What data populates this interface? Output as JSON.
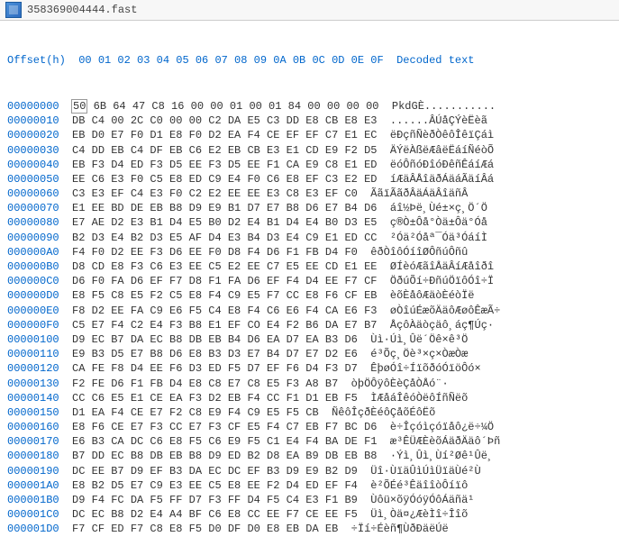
{
  "title": "358369004444.fast",
  "header": {
    "offset": "Offset(h)",
    "cols": "00 01 02 03 04 05 06 07 08 09 0A 0B 0C 0D 0E 0F",
    "decoded": "Decoded text"
  },
  "rows": [
    {
      "off": "00000000",
      "b": "50 6B 64 47 C8 16 00 00 01 00 01 84 00 00 00 00",
      "t": "PkdGÈ..........."
    },
    {
      "off": "00000010",
      "b": "DB C4 00 2C C0 00 00 C2 DA E5 C3 DD E8 CB E8 E3",
      "t": "......ÂÚåÇÝèËèã"
    },
    {
      "off": "00000020",
      "b": "EB D0 E7 F0 D1 E8 F0 D2 EA F4 CE EF EF C7 E1 EC",
      "t": "ëÐçñÑèðÒêôÎêïÇáì"
    },
    {
      "off": "00000030",
      "b": "C4 DD EB C4 DF EB C6 E2 EB CB E3 E1 CD E9 F2 D5",
      "t": "ÄÝëÀßëÆâëËáíÑéòÕ"
    },
    {
      "off": "00000040",
      "b": "EB F3 D4 ED F3 D5 EE F3 D5 EE F1 CA E9 C8 E1 ED",
      "t": "ëóÔñóÐîóÐêñÊáíÆá"
    },
    {
      "off": "00000050",
      "b": "EE C6 E3 F0 C5 E8 ED C9 E4 F0 C6 E8 EF C3 E2 ED",
      "t": "íÆäÂÅîäðÁäáÃäíÂá"
    },
    {
      "off": "00000060",
      "b": "C3 E3 EF C4 E3 F0 C2 E2 EE EE E3 C8 E3 EF C0",
      "t": "ÃãïÃãðÂäÁäÂîäñÂ"
    },
    {
      "off": "00000070",
      "b": "E1 EE BD DE EB B8 D9 E9 B1 D7 E7 B8 D6 E7 B4 D6",
      "t": "áî½Þë¸Ùé±×ç¸Ö´Ö"
    },
    {
      "off": "00000080",
      "b": "E7 AE D2 E3 B1 D4 E5 B0 D2 E4 B1 D4 E4 B0 D3 E5",
      "t": "ç®Ò±Ôå°Òä±Ôä°Óå"
    },
    {
      "off": "00000090",
      "b": "B2 D3 E4 B2 D3 E5 AF D4 E3 B4 D3 E4 C9 E1 ED CC",
      "t": "²Óä²Óåª¯Óä³ÓáíÌ"
    },
    {
      "off": "000000A0",
      "b": "F4 F0 D2 EE F3 D6 EE F0 D8 F4 D6 F1 FB D4 F0",
      "t": "êðÒîôÓíîØÔñúÔñû"
    },
    {
      "off": "000000B0",
      "b": "D8 CD E8 F3 C6 E3 EE C5 E2 EE C7 E5 EE CD E1 EE",
      "t": "ØÍèóÆãîÅäÂíÆåîðî"
    },
    {
      "off": "000000C0",
      "b": "D6 F0 FA D6 EF F7 D8 F1 FA D6 EF F4 D4 EE F7 CF",
      "t": "ÖðúÕí÷ÐñúÖïôÓî÷Ï"
    },
    {
      "off": "000000D0",
      "b": "E8 F5 C8 E5 F2 C5 E8 F4 C9 E5 F7 CC E8 F6 CF EB",
      "t": "èõÈåôÆäòÈéòÏë"
    },
    {
      "off": "000000E0",
      "b": "F8 D2 EE FA C9 E6 F5 C4 E8 F4 C6 E6 F4 CA E6 F3",
      "t": "øÒîúÉæõÄäôÆøôÊæÃ÷"
    },
    {
      "off": "000000F0",
      "b": "C5 E7 F4 C2 E4 F3 B8 E1 EF CO E4 F2 B6 DA E7 B7",
      "t": "ÅçôÀäòçäô¸áç¶Úç·"
    },
    {
      "off": "00000100",
      "b": "D9 EC B7 DA EC B8 DB EB B4 D6 EA D7 EA B3 D6",
      "t": "Ùì·Úì¸Ûë´Öê×ê³Ö"
    },
    {
      "off": "00000110",
      "b": "E9 B3 D5 E7 B8 D6 E8 B3 D3 E7 B4 D7 E7 D2 E6",
      "t": "é³Õç¸Öè³×ç×ÒæÒæ"
    },
    {
      "off": "00000120",
      "b": "CA FE F8 D4 EE F6 D3 ED F5 D7 EF F6 D4 F3 D7",
      "t": "ÊþøÓî÷ÍïõðóÓïöÔó×"
    },
    {
      "off": "00000130",
      "b": "F2 FE D6 F1 FB D4 E8 C8 E7 C8 E5 F3 A8 B7",
      "t": "òþÖÔÿôÈèÇåÒÅó¨·"
    },
    {
      "off": "00000140",
      "b": "CC C6 E5 E1 CE EA F3 D2 EB F4 CC F1 D1 EB F5",
      "t": "ÌÆåáÎêóÒëôÍñÑëõ"
    },
    {
      "off": "00000150",
      "b": "D1 EA F4 CE E7 F2 C8 E9 F4 C9 E5 F5 CB",
      "t": "ÑêôÎçðÈéôÇåõÉôËõ"
    },
    {
      "off": "00000160",
      "b": "E8 F6 CE E7 F3 CC E7 F3 CF E5 F4 C7 EB F7 BC D6",
      "t": "è÷Îçóìçóïåô¿ë÷¼Ö"
    },
    {
      "off": "00000170",
      "b": "E6 B3 CA DC C6 E8 F5 C6 E9 F5 C1 E4 F4 BA DE F1",
      "t": "æ³ÊÜÆÈèõÁäðÄäô´Þñ"
    },
    {
      "off": "00000180",
      "b": "B7 DD EC B8 DB EB B8 D9 ED B2 D8 EA B9 DB EB B8",
      "t": "·Ýì¸Ûì¸Ùí²Øê¹Ûë¸"
    },
    {
      "off": "00000190",
      "b": "DC EE B7 D9 EF B3 DA EC DC EF B3 D9 E9 B2 D9",
      "t": "Üî·ÙïäÛìÚìÜïäÙé²Ù"
    },
    {
      "off": "000001A0",
      "b": "E8 B2 D5 E7 C9 E3 EE C5 E8 EE F2 D4 ED EF F4",
      "t": "è²ÕÉé³ÊäîîòÔíïô"
    },
    {
      "off": "000001B0",
      "b": "D9 F4 FC DA F5 FF D7 F3 FF D4 F5 C4 E3 F1 B9",
      "t": "Ùôü×õÿÓóÿÓôÁäñä¹"
    },
    {
      "off": "000001C0",
      "b": "DC EC B8 D2 E4 A4 BF C6 E8 CC EE F7 CE EE F5",
      "t": "Üì¸Òä¤¿ÆèÌî÷Îîõ"
    },
    {
      "off": "000001D0",
      "b": "F7 CF ED F7 C8 E8 F5 D0 DF D0 E8 EB DA EB",
      "t": "÷Ïí÷Éèñ¶ÙðÐäëÚë"
    }
  ]
}
